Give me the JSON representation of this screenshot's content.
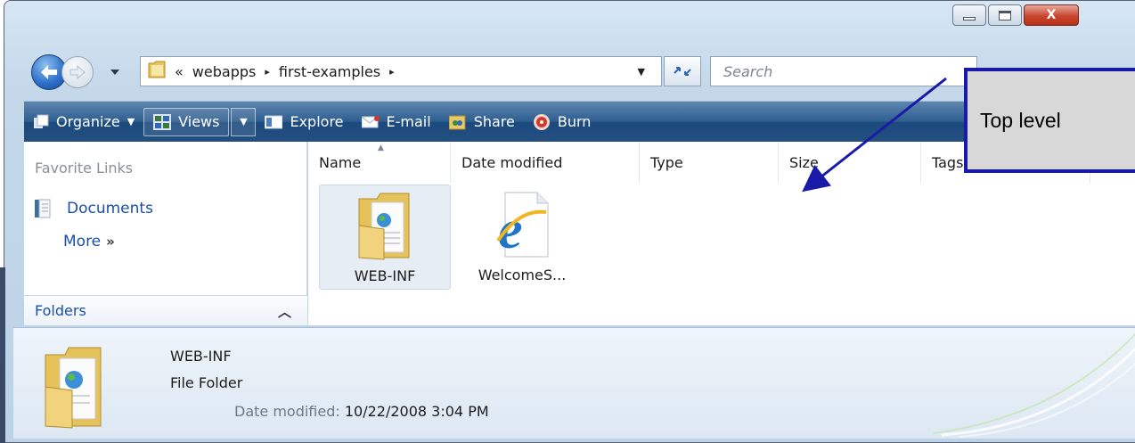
{
  "window": {
    "close_glyph": "X"
  },
  "address": {
    "overflow": "«",
    "crumbs": [
      "webapps",
      "first-examples"
    ],
    "separator": "▸",
    "search_placeholder": "Search"
  },
  "toolbar": {
    "organize": "Organize",
    "views": "Views",
    "explore": "Explore",
    "email": "E-mail",
    "share": "Share",
    "burn": "Burn"
  },
  "sidebar": {
    "favorites_title": "Favorite Links",
    "documents": "Documents",
    "more": "More",
    "more_arrows": "»",
    "folders": "Folders"
  },
  "columns": [
    "Name",
    "Date modified",
    "Type",
    "Size",
    "Tags"
  ],
  "files": [
    {
      "name": "WEB-INF",
      "icon": "folder-icon",
      "selected": true
    },
    {
      "name": "WelcomeS...",
      "icon": "ie-html-icon",
      "selected": false
    }
  ],
  "details": {
    "name": "WEB-INF",
    "type": "File Folder",
    "modified_label": "Date modified:",
    "modified_value": "10/22/2008 3:04 PM"
  },
  "callout": {
    "text": "Top level"
  },
  "colors": {
    "accent": "#1a1aa8",
    "link": "#1a4fa8",
    "toolbar": "#2e5d8f"
  }
}
